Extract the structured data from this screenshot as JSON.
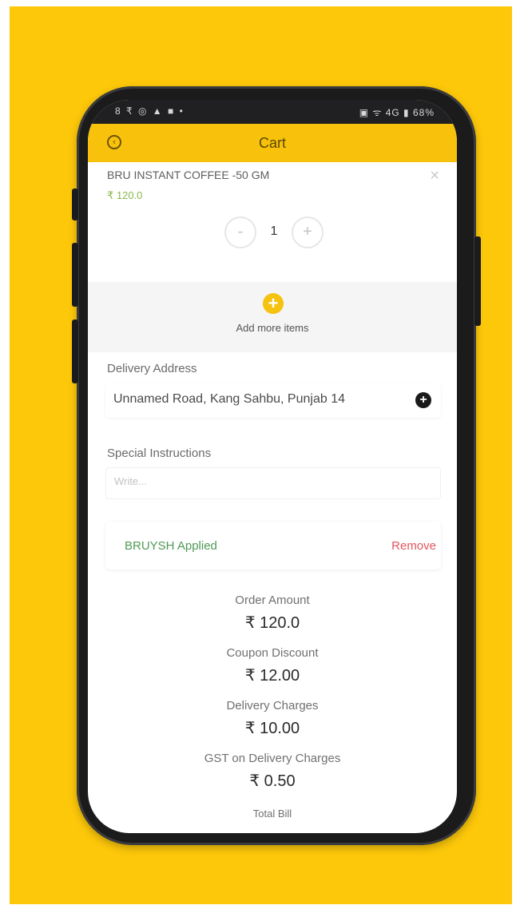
{
  "status_bar": {
    "left": "8 ₹ ◎ ▲ ■ •",
    "right": "▣ ᯤ 4G ▮ 68%"
  },
  "header": {
    "back_icon": "back-circle-icon",
    "title": "Cart"
  },
  "cart_item": {
    "name": "BRU INSTANT COFFEE -50 GM",
    "price": "₹ 120.0",
    "close_icon": "×",
    "quantity": "1",
    "minus_label": "-",
    "plus_label": "+"
  },
  "add_more": {
    "icon": "+",
    "label": "Add more items"
  },
  "delivery": {
    "label": "Delivery Address",
    "address": "Unnamed Road, Kang Sahbu, Punjab 14",
    "edit_icon": "+"
  },
  "instructions": {
    "label": "Special Instructions",
    "placeholder": "Write..."
  },
  "coupon": {
    "applied_text": "BRUYSH Applied",
    "remove_label": "Remove"
  },
  "summary": {
    "order_amount_label": "Order Amount",
    "order_amount": "₹ 120.0",
    "coupon_discount_label": "Coupon Discount",
    "coupon_discount": "₹ 12.00",
    "delivery_charges_label": "Delivery Charges",
    "delivery_charges": "₹ 10.00",
    "gst_label": "GST on Delivery Charges",
    "gst": "₹ 0.50",
    "total_label": "Total Bill"
  },
  "colors": {
    "background": "#fdc80a",
    "app_bar": "#f8c20c",
    "price_green": "#8bb84d",
    "coupon_green": "#4f9a55",
    "remove_red": "#e4565e"
  }
}
